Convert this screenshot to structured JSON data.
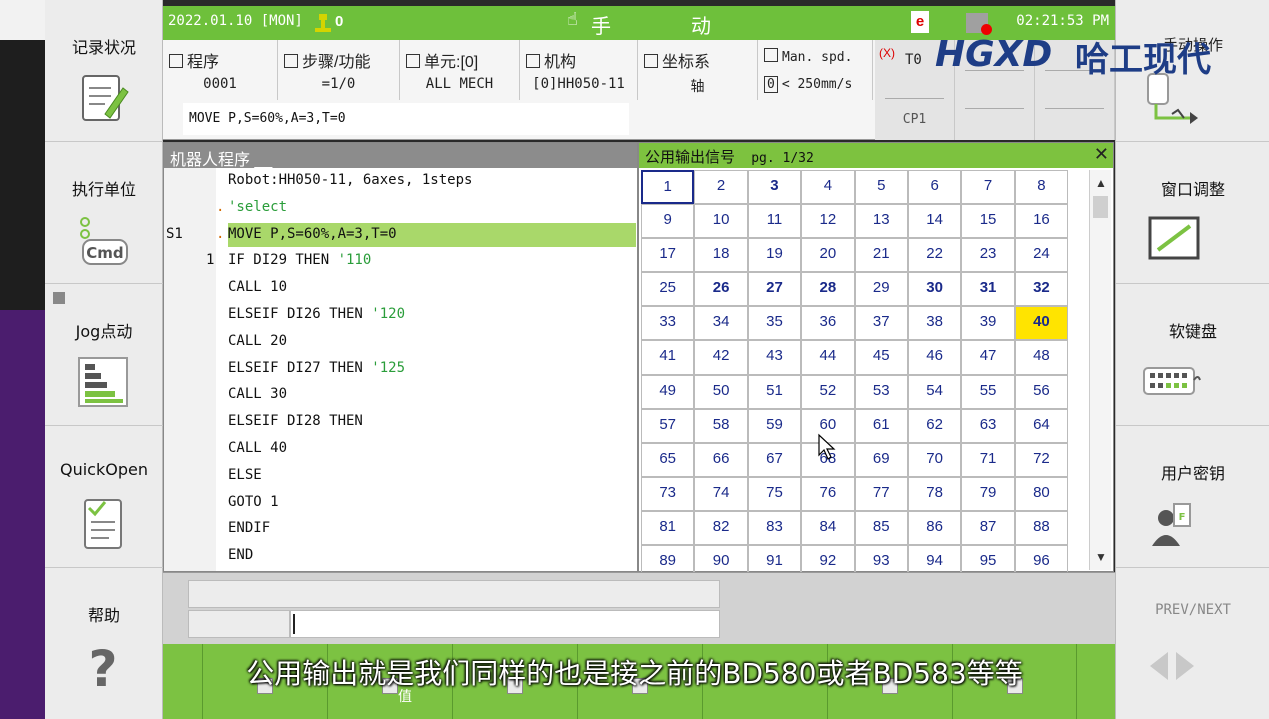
{
  "status_bar": {
    "date": "2022.01.10 [MON]",
    "mode_left": "手",
    "mode_right": "动",
    "e_badge": "e",
    "time": "02:21:53 PM",
    "counter": "0"
  },
  "info": {
    "program_label": "程序",
    "program_value": "0001",
    "step_label": "步骤/功能",
    "step_value": "=1/0",
    "unit_label": "单元:[0]",
    "unit_value": "ALL MECH",
    "mech_label": "机构",
    "mech_value": "[0]HH050-11",
    "coord_label": "坐标系",
    "coord_value": "轴",
    "speed_label": "Man. spd.",
    "speed_value": "< 250mm/s",
    "speed_box": "0",
    "tool_label": "T0",
    "tool_x": "(X)",
    "cp_label": "CP1",
    "command": "MOVE P,S=60%,A=3,T=0",
    "tool_head": "手动操作"
  },
  "logo": {
    "brand": "哈工现代",
    "mark": "HGXD"
  },
  "program_panel": {
    "title": "机器人程序 __",
    "lines": [
      {
        "label": "",
        "num": "",
        "dot": "",
        "text": "Robot:HH050-11, 6axes, 1steps",
        "comment": "",
        "hl": false
      },
      {
        "label": "",
        "num": "",
        "dot": ".",
        "text": "",
        "comment": "'select",
        "hl": false
      },
      {
        "label": "S1",
        "num": "",
        "dot": ".",
        "text": "MOVE P,S=60%,A=3,T=0",
        "comment": "",
        "hl": true
      },
      {
        "label": "",
        "num": "1",
        "dot": "",
        "text": "IF DI29 THEN ",
        "comment": "'110",
        "hl": false
      },
      {
        "label": "",
        "num": "",
        "dot": "",
        "text": "CALL 10",
        "comment": "",
        "hl": false
      },
      {
        "label": "",
        "num": "",
        "dot": "",
        "text": "ELSEIF DI26 THEN ",
        "comment": "'120",
        "hl": false
      },
      {
        "label": "",
        "num": "",
        "dot": "",
        "text": "CALL 20",
        "comment": "",
        "hl": false
      },
      {
        "label": "",
        "num": "",
        "dot": "",
        "text": "ELSEIF DI27 THEN ",
        "comment": "'125",
        "hl": false
      },
      {
        "label": "",
        "num": "",
        "dot": "",
        "text": "CALL 30",
        "comment": "",
        "hl": false
      },
      {
        "label": "",
        "num": "",
        "dot": "",
        "text": "ELSEIF DI28 THEN",
        "comment": "",
        "hl": false
      },
      {
        "label": "",
        "num": "",
        "dot": "",
        "text": "CALL 40",
        "comment": "",
        "hl": false
      },
      {
        "label": "",
        "num": "",
        "dot": "",
        "text": "ELSE",
        "comment": "",
        "hl": false
      },
      {
        "label": "",
        "num": "",
        "dot": "",
        "text": "GOTO 1",
        "comment": "",
        "hl": false
      },
      {
        "label": "",
        "num": "",
        "dot": "",
        "text": "ENDIF",
        "comment": "",
        "hl": false
      },
      {
        "label": "",
        "num": "",
        "dot": "",
        "text": "END",
        "comment": "",
        "hl": false
      }
    ]
  },
  "signal_panel": {
    "title": "公用输出信号",
    "page": "pg. 1/32",
    "close": "✕",
    "scroll_up": "▲",
    "scroll_down": "▼",
    "cells": [
      "1",
      "2",
      "3",
      "4",
      "5",
      "6",
      "7",
      "8",
      "9",
      "10",
      "11",
      "12",
      "13",
      "14",
      "15",
      "16",
      "17",
      "18",
      "19",
      "20",
      "21",
      "22",
      "23",
      "24",
      "25",
      "26",
      "27",
      "28",
      "29",
      "30",
      "31",
      "32",
      "33",
      "34",
      "35",
      "36",
      "37",
      "38",
      "39",
      "40",
      "41",
      "42",
      "43",
      "44",
      "45",
      "46",
      "47",
      "48",
      "49",
      "50",
      "51",
      "52",
      "53",
      "54",
      "55",
      "56",
      "57",
      "58",
      "59",
      "60",
      "61",
      "62",
      "63",
      "64",
      "65",
      "66",
      "67",
      "68",
      "69",
      "70",
      "71",
      "72",
      "73",
      "74",
      "75",
      "76",
      "77",
      "78",
      "79",
      "80",
      "81",
      "82",
      "83",
      "84",
      "85",
      "86",
      "87",
      "88",
      "89",
      "90",
      "91",
      "92",
      "93",
      "94",
      "95",
      "96"
    ],
    "bold_cells": [
      "3",
      "26",
      "27",
      "28",
      "30",
      "31",
      "32",
      "40"
    ],
    "on_cells": [
      "40"
    ],
    "selected_cell": "1"
  },
  "left_sidebar": [
    {
      "label": "记录状况",
      "icon": "notepad-pencil-icon"
    },
    {
      "label": "执行单位",
      "icon": "cmd-icon"
    },
    {
      "label": "Jog点动",
      "icon": "jog-bars-icon"
    },
    {
      "label": "QuickOpen",
      "icon": "quickopen-doc-icon"
    },
    {
      "label": "帮助",
      "icon": "question-mark-icon"
    }
  ],
  "right_sidebar": [
    {
      "label": "",
      "icon": "manual-operation-icon"
    },
    {
      "label": "窗口调整",
      "icon": "window-resize-icon"
    },
    {
      "label": "软键盘",
      "icon": "keyboard-icon"
    },
    {
      "label": "用户密钥",
      "icon": "user-key-icon"
    },
    {
      "label": "PREV/NEXT",
      "icon": "prev-next-arrows-icon"
    }
  ],
  "fkeys": [
    {
      "label": "ء"
    },
    {
      "label": "值"
    },
    {
      "label": ""
    },
    {
      "label": ""
    },
    {
      "label": ""
    },
    {
      "label": ""
    },
    {
      "label": ""
    }
  ],
  "subtitle": "公用输出就是我们同样的也是接之前的BD580或者BD583等等",
  "colors": {
    "status_green": "#6ec03b",
    "signal_on": "#ffe400",
    "signal_text": "#1a2a8a",
    "highlight_line": "#a9d86a"
  }
}
